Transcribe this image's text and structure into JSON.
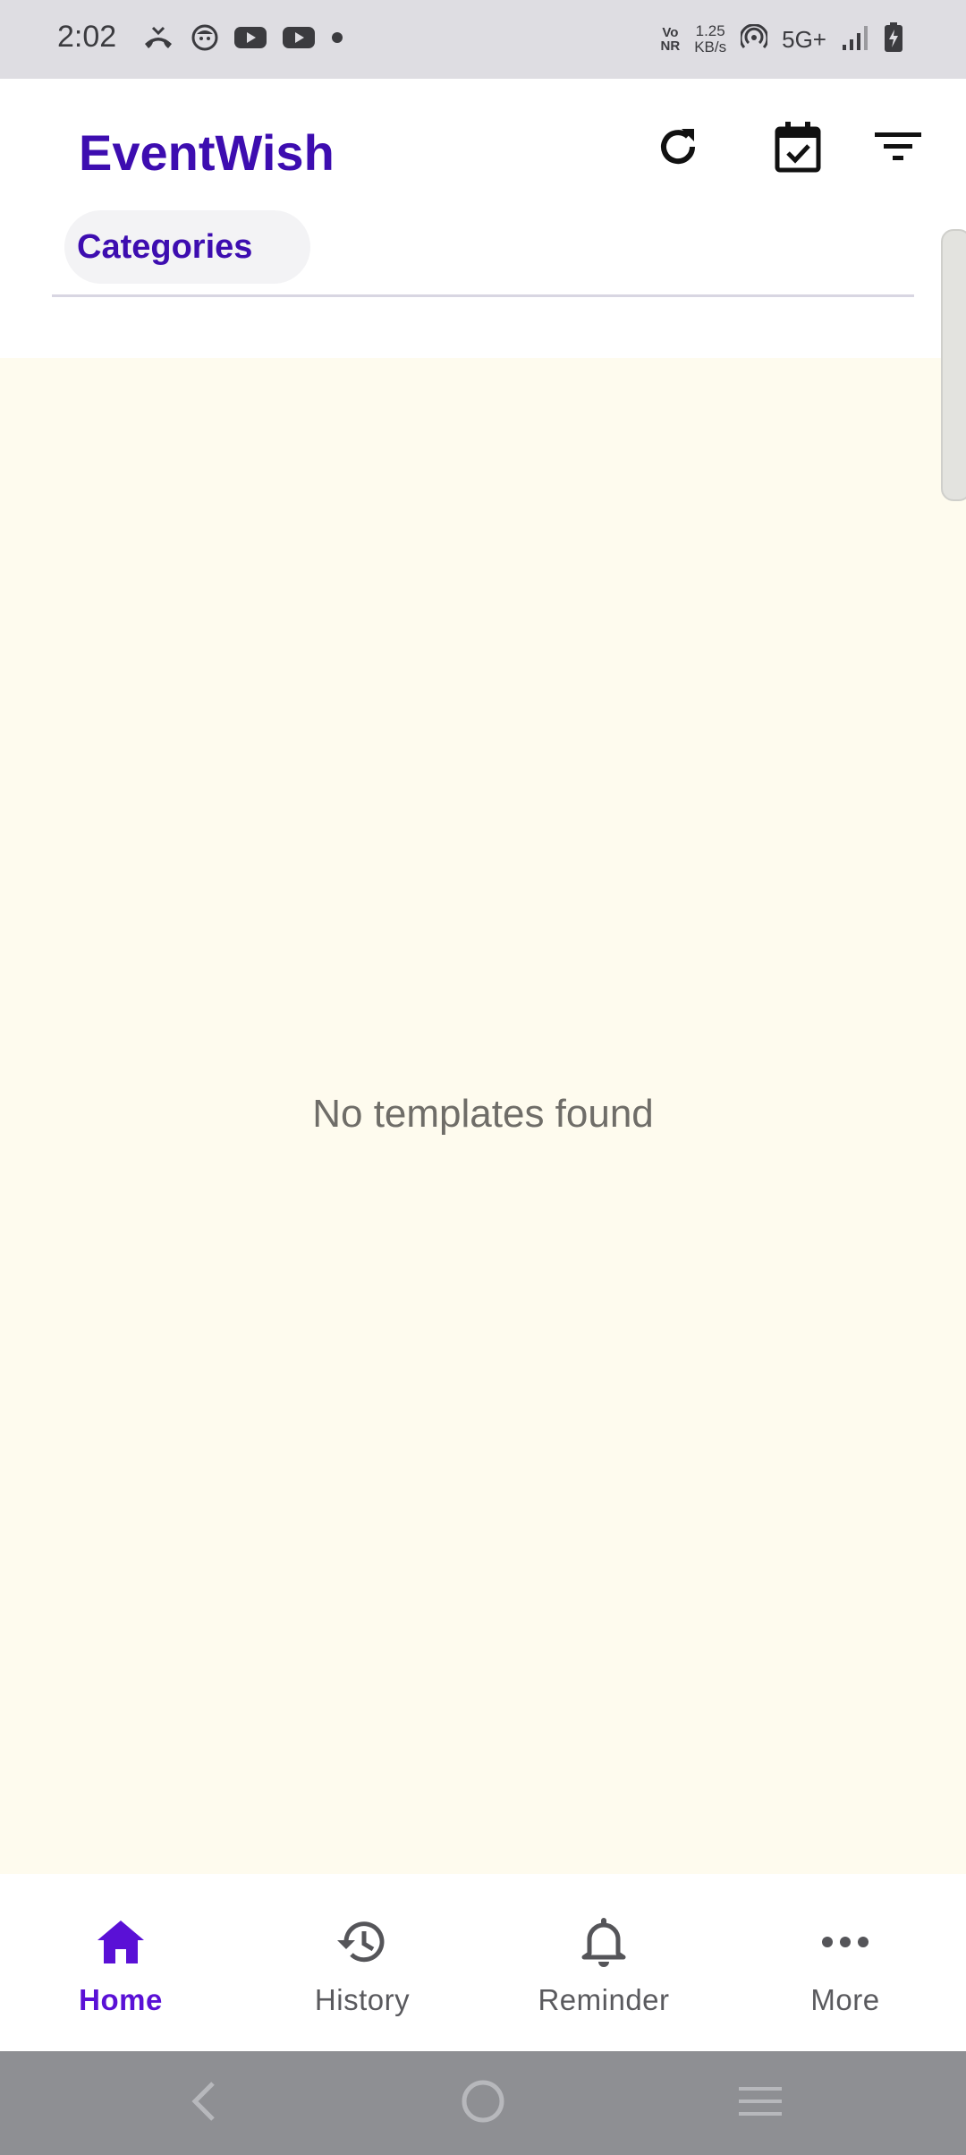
{
  "status_bar": {
    "time": "2:02",
    "vonr_top": "Vo",
    "vonr_bottom": "NR",
    "speed_value": "1.25",
    "speed_unit": "KB/s",
    "network": "5G+"
  },
  "app_bar": {
    "title": "EventWish",
    "category_chip": "Categories"
  },
  "main": {
    "empty_message": "No templates found"
  },
  "bottom_nav": {
    "items": [
      {
        "label": "Home",
        "icon": "home-icon"
      },
      {
        "label": "History",
        "icon": "history-icon"
      },
      {
        "label": "Reminder",
        "icon": "bell-icon"
      },
      {
        "label": "More",
        "icon": "more-icon"
      }
    ],
    "active": "Home"
  },
  "colors": {
    "accent": "#3d0db0",
    "nav_active": "#5a10d6",
    "content_bg": "#fefbee",
    "status_bar_bg": "#dedde2",
    "system_nav_bg": "#8e8f93"
  }
}
